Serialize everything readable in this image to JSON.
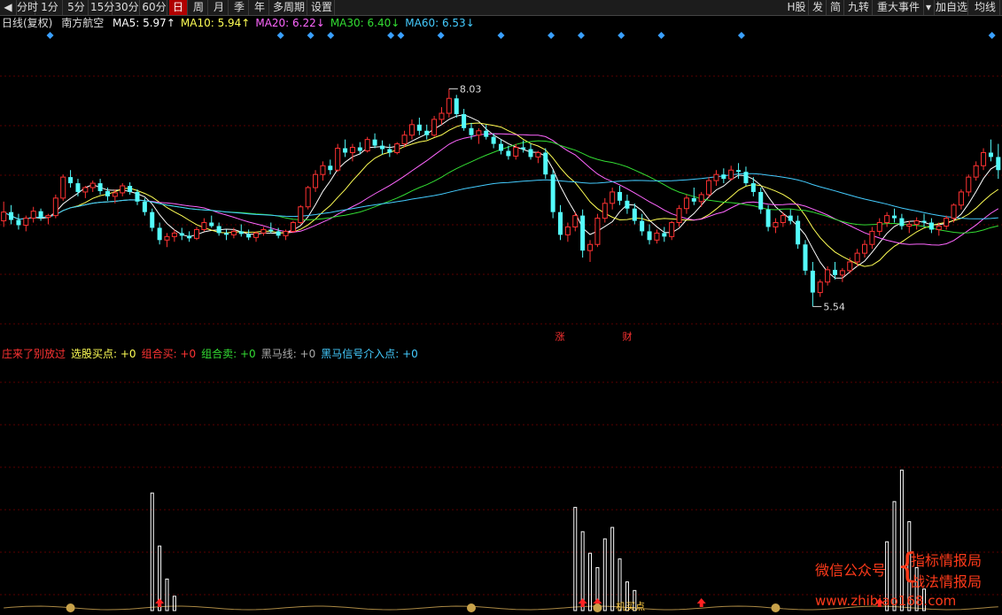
{
  "toolbar": {
    "left_buttons": [
      "分时",
      "1分",
      "5分",
      "15分",
      "30分",
      "60分",
      "日",
      "周",
      "月",
      "季",
      "年",
      "多周期",
      "设置"
    ],
    "active": "日",
    "right_buttons": [
      "H股",
      "发",
      "简",
      "九转",
      "重大事件",
      "加自选",
      "均线"
    ]
  },
  "main": {
    "period_label": "日线(复权)",
    "stock_name": "南方航空",
    "ma": [
      {
        "label": "MA5: 5.97↑",
        "color": "#ffffff"
      },
      {
        "label": "MA10: 5.94↑",
        "color": "#ffff55"
      },
      {
        "label": "MA20: 6.22↓",
        "color": "#ff66ff"
      },
      {
        "label": "MA30: 6.40↓",
        "color": "#33dd33"
      },
      {
        "label": "MA60: 6.53↓",
        "color": "#44ccff"
      }
    ],
    "high_label": "8.03",
    "low_label": "5.54",
    "markers": [
      "涨",
      "财"
    ]
  },
  "sub": {
    "legend": [
      {
        "label": "庄来了别放过",
        "color": "#ff3333"
      },
      {
        "label": "选股买点: +0",
        "color": "#ffff55"
      },
      {
        "label": "组合买: +0",
        "color": "#ff3333"
      },
      {
        "label": "组合卖: +0",
        "color": "#33dd33"
      },
      {
        "label": "黑马线: +0",
        "color": "#aaaaaa"
      },
      {
        "label": "黑马信号介入点: +0",
        "color": "#44ccff"
      }
    ],
    "annotation": "机买点"
  },
  "watermark": {
    "line1": "微信公众号",
    "line2a": "指标情报局",
    "line2b": "战法情报局",
    "url": "www.zhibiao168.com"
  },
  "chart_data": {
    "type": "candlestick",
    "title": "南方航空 日线(复权)",
    "ylim": [
      5.2,
      8.6
    ],
    "price_high": 8.03,
    "price_low": 5.54,
    "volume_note": "sub-panel indicator bars (relative)",
    "candles": [
      [
        6.52,
        6.74,
        6.45,
        6.62
      ],
      [
        6.62,
        6.7,
        6.48,
        6.53
      ],
      [
        6.53,
        6.6,
        6.42,
        6.47
      ],
      [
        6.47,
        6.58,
        6.4,
        6.55
      ],
      [
        6.55,
        6.68,
        6.5,
        6.63
      ],
      [
        6.63,
        6.66,
        6.52,
        6.56
      ],
      [
        6.56,
        6.6,
        6.48,
        6.58
      ],
      [
        6.58,
        6.82,
        6.55,
        6.78
      ],
      [
        6.78,
        7.05,
        6.75,
        7.02
      ],
      [
        7.02,
        7.1,
        6.9,
        6.95
      ],
      [
        6.95,
        7.0,
        6.8,
        6.85
      ],
      [
        6.85,
        6.92,
        6.78,
        6.9
      ],
      [
        6.9,
        6.98,
        6.85,
        6.95
      ],
      [
        6.95,
        7.0,
        6.82,
        6.86
      ],
      [
        6.86,
        6.9,
        6.75,
        6.8
      ],
      [
        6.8,
        6.88,
        6.72,
        6.84
      ],
      [
        6.84,
        6.95,
        6.8,
        6.92
      ],
      [
        6.92,
        6.96,
        6.82,
        6.85
      ],
      [
        6.85,
        6.88,
        6.7,
        6.74
      ],
      [
        6.74,
        6.78,
        6.58,
        6.62
      ],
      [
        6.62,
        6.66,
        6.4,
        6.44
      ],
      [
        6.44,
        6.5,
        6.25,
        6.3
      ],
      [
        6.3,
        6.38,
        6.22,
        6.34
      ],
      [
        6.34,
        6.42,
        6.28,
        6.38
      ],
      [
        6.38,
        6.44,
        6.3,
        6.35
      ],
      [
        6.35,
        6.4,
        6.28,
        6.32
      ],
      [
        6.32,
        6.45,
        6.3,
        6.42
      ],
      [
        6.42,
        6.55,
        6.4,
        6.5
      ],
      [
        6.5,
        6.58,
        6.44,
        6.46
      ],
      [
        6.46,
        6.5,
        6.35,
        6.38
      ],
      [
        6.38,
        6.42,
        6.3,
        6.36
      ],
      [
        6.36,
        6.44,
        6.32,
        6.4
      ],
      [
        6.4,
        6.48,
        6.34,
        6.37
      ],
      [
        6.37,
        6.42,
        6.3,
        6.33
      ],
      [
        6.33,
        6.4,
        6.28,
        6.38
      ],
      [
        6.38,
        6.45,
        6.35,
        6.42
      ],
      [
        6.42,
        6.5,
        6.38,
        6.4
      ],
      [
        6.4,
        6.44,
        6.32,
        6.35
      ],
      [
        6.35,
        6.42,
        6.3,
        6.4
      ],
      [
        6.4,
        6.52,
        6.38,
        6.5
      ],
      [
        6.5,
        6.7,
        6.48,
        6.68
      ],
      [
        6.68,
        6.92,
        6.65,
        6.9
      ],
      [
        6.9,
        7.1,
        6.85,
        7.05
      ],
      [
        7.05,
        7.2,
        6.98,
        7.15
      ],
      [
        7.15,
        7.22,
        7.05,
        7.1
      ],
      [
        7.1,
        7.4,
        7.08,
        7.35
      ],
      [
        7.35,
        7.45,
        7.25,
        7.3
      ],
      [
        7.3,
        7.4,
        7.2,
        7.36
      ],
      [
        7.36,
        7.42,
        7.28,
        7.32
      ],
      [
        7.32,
        7.48,
        7.3,
        7.45
      ],
      [
        7.45,
        7.52,
        7.35,
        7.38
      ],
      [
        7.38,
        7.44,
        7.28,
        7.34
      ],
      [
        7.34,
        7.4,
        7.25,
        7.3
      ],
      [
        7.3,
        7.42,
        7.28,
        7.4
      ],
      [
        7.4,
        7.55,
        7.36,
        7.5
      ],
      [
        7.5,
        7.68,
        7.45,
        7.62
      ],
      [
        7.62,
        7.7,
        7.5,
        7.55
      ],
      [
        7.55,
        7.62,
        7.45,
        7.5
      ],
      [
        7.5,
        7.72,
        7.48,
        7.68
      ],
      [
        7.68,
        7.82,
        7.62,
        7.75
      ],
      [
        7.75,
        8.03,
        7.7,
        7.92
      ],
      [
        7.92,
        7.96,
        7.7,
        7.74
      ],
      [
        7.74,
        7.8,
        7.55,
        7.58
      ],
      [
        7.58,
        7.64,
        7.45,
        7.5
      ],
      [
        7.5,
        7.58,
        7.4,
        7.55
      ],
      [
        7.55,
        7.62,
        7.45,
        7.48
      ],
      [
        7.48,
        7.52,
        7.35,
        7.4
      ],
      [
        7.4,
        7.45,
        7.28,
        7.32
      ],
      [
        7.32,
        7.38,
        7.22,
        7.26
      ],
      [
        7.26,
        7.4,
        7.22,
        7.36
      ],
      [
        7.36,
        7.44,
        7.3,
        7.34
      ],
      [
        7.34,
        7.4,
        7.22,
        7.25
      ],
      [
        7.25,
        7.32,
        7.18,
        7.3
      ],
      [
        7.3,
        7.35,
        7.0,
        7.05
      ],
      [
        7.05,
        7.1,
        6.55,
        6.62
      ],
      [
        6.62,
        6.7,
        6.3,
        6.36
      ],
      [
        6.36,
        6.5,
        6.28,
        6.45
      ],
      [
        6.45,
        6.62,
        6.4,
        6.58
      ],
      [
        6.58,
        6.65,
        6.1,
        6.18
      ],
      [
        6.18,
        6.3,
        6.05,
        6.25
      ],
      [
        6.25,
        6.6,
        6.22,
        6.55
      ],
      [
        6.55,
        6.78,
        6.5,
        6.72
      ],
      [
        6.72,
        6.9,
        6.65,
        6.85
      ],
      [
        6.85,
        6.92,
        6.7,
        6.75
      ],
      [
        6.75,
        6.82,
        6.6,
        6.66
      ],
      [
        6.66,
        6.72,
        6.48,
        6.52
      ],
      [
        6.52,
        6.6,
        6.35,
        6.4
      ],
      [
        6.4,
        6.48,
        6.25,
        6.3
      ],
      [
        6.3,
        6.42,
        6.26,
        6.38
      ],
      [
        6.38,
        6.45,
        6.28,
        6.34
      ],
      [
        6.34,
        6.52,
        6.3,
        6.5
      ],
      [
        6.5,
        6.7,
        6.45,
        6.66
      ],
      [
        6.66,
        6.82,
        6.6,
        6.78
      ],
      [
        6.78,
        6.9,
        6.7,
        6.74
      ],
      [
        6.74,
        6.85,
        6.68,
        6.82
      ],
      [
        6.82,
        7.02,
        6.78,
        6.98
      ],
      [
        6.98,
        7.1,
        6.92,
        7.05
      ],
      [
        7.05,
        7.12,
        6.95,
        7.0
      ],
      [
        7.0,
        7.15,
        6.98,
        7.1
      ],
      [
        7.1,
        7.18,
        7.0,
        7.08
      ],
      [
        7.08,
        7.14,
        6.92,
        6.95
      ],
      [
        6.95,
        7.02,
        6.8,
        6.85
      ],
      [
        6.85,
        6.9,
        6.6,
        6.65
      ],
      [
        6.65,
        6.7,
        6.4,
        6.45
      ],
      [
        6.45,
        6.55,
        6.38,
        6.5
      ],
      [
        6.5,
        6.62,
        6.45,
        6.58
      ],
      [
        6.58,
        6.65,
        6.48,
        6.52
      ],
      [
        6.52,
        6.58,
        6.2,
        6.25
      ],
      [
        6.25,
        6.3,
        5.9,
        5.95
      ],
      [
        5.95,
        6.05,
        5.54,
        5.7
      ],
      [
        5.7,
        5.85,
        5.65,
        5.82
      ],
      [
        5.82,
        6.0,
        5.78,
        5.96
      ],
      [
        5.96,
        6.05,
        5.85,
        5.9
      ],
      [
        5.9,
        5.98,
        5.82,
        5.95
      ],
      [
        5.95,
        6.1,
        5.92,
        6.05
      ],
      [
        6.05,
        6.2,
        6.0,
        6.15
      ],
      [
        6.15,
        6.3,
        6.1,
        6.25
      ],
      [
        6.25,
        6.45,
        6.2,
        6.4
      ],
      [
        6.4,
        6.55,
        6.35,
        6.5
      ],
      [
        6.5,
        6.62,
        6.45,
        6.58
      ],
      [
        6.58,
        6.66,
        6.5,
        6.55
      ],
      [
        6.55,
        6.6,
        6.42,
        6.46
      ],
      [
        6.46,
        6.52,
        6.38,
        6.48
      ],
      [
        6.48,
        6.56,
        6.42,
        6.52
      ],
      [
        6.52,
        6.6,
        6.45,
        6.5
      ],
      [
        6.5,
        6.55,
        6.38,
        6.42
      ],
      [
        6.42,
        6.5,
        6.35,
        6.46
      ],
      [
        6.46,
        6.58,
        6.42,
        6.55
      ],
      [
        6.55,
        6.72,
        6.5,
        6.7
      ],
      [
        6.7,
        6.88,
        6.65,
        6.85
      ],
      [
        6.85,
        7.05,
        6.8,
        7.02
      ],
      [
        7.02,
        7.2,
        6.98,
        7.15
      ],
      [
        7.15,
        7.35,
        7.1,
        7.3
      ],
      [
        7.3,
        7.45,
        7.2,
        7.25
      ],
      [
        7.25,
        7.4,
        7.0,
        7.1
      ]
    ],
    "ma_series": [
      "MA5",
      "MA10",
      "MA20",
      "MA30",
      "MA60"
    ],
    "sub_bars": [
      {
        "i": 20,
        "v": 0.82
      },
      {
        "i": 21,
        "v": 0.45
      },
      {
        "i": 22,
        "v": 0.22
      },
      {
        "i": 23,
        "v": 0.1
      },
      {
        "i": 77,
        "v": 0.72
      },
      {
        "i": 78,
        "v": 0.55
      },
      {
        "i": 79,
        "v": 0.4
      },
      {
        "i": 80,
        "v": 0.3
      },
      {
        "i": 81,
        "v": 0.5
      },
      {
        "i": 82,
        "v": 0.58
      },
      {
        "i": 83,
        "v": 0.36
      },
      {
        "i": 84,
        "v": 0.2
      },
      {
        "i": 85,
        "v": 0.14
      },
      {
        "i": 119,
        "v": 0.48
      },
      {
        "i": 120,
        "v": 0.76
      },
      {
        "i": 121,
        "v": 0.98
      },
      {
        "i": 122,
        "v": 0.62
      },
      {
        "i": 123,
        "v": 0.3
      },
      {
        "i": 124,
        "v": 0.15
      }
    ]
  }
}
